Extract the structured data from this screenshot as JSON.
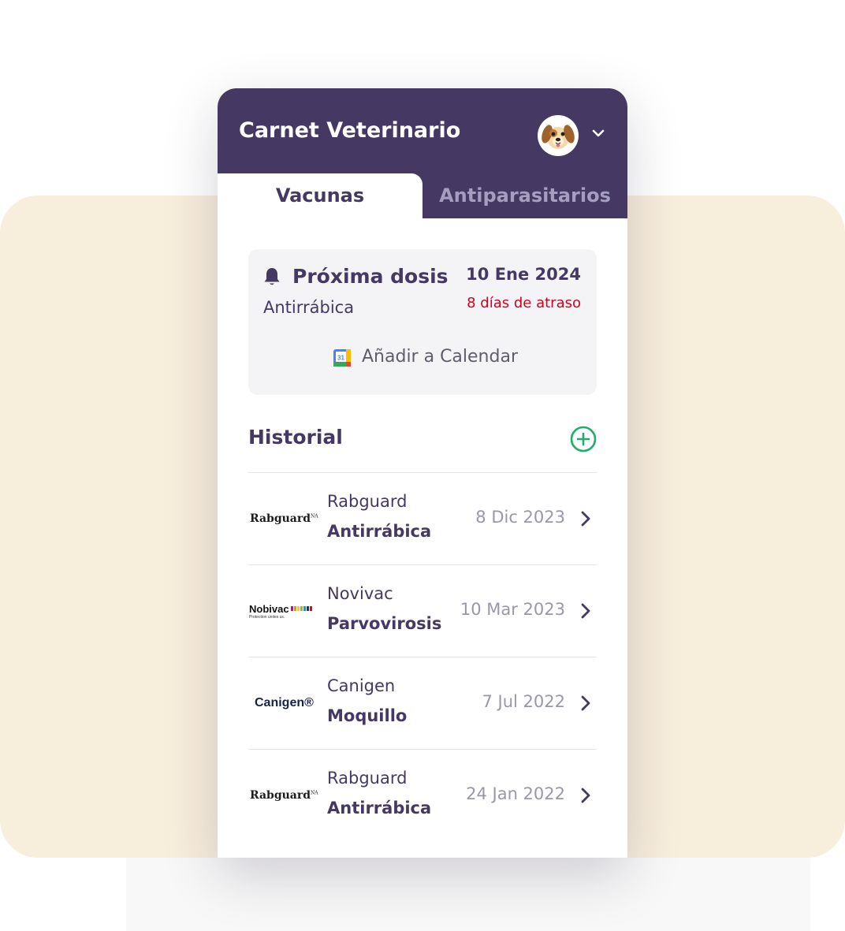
{
  "header": {
    "title": "Carnet Veterinario"
  },
  "tabs": [
    {
      "label": "Vacunas",
      "active": true
    },
    {
      "label": "Antiparasitarios",
      "active": false
    }
  ],
  "next_dose": {
    "title": "Próxima dosis",
    "vaccine": "Antirrábica",
    "date": "10 Ene 2024",
    "overdue": "8 días de atraso",
    "calendar_button": "Añadir a Calendar",
    "calendar_icon_text": "31"
  },
  "history": {
    "title": "Historial",
    "items": [
      {
        "logo": "Rabguard",
        "logo_mark": "NA",
        "brand": "Rabguard",
        "disease": "Antirrábica",
        "date": "8 Dic 2023"
      },
      {
        "logo": "Nobivac",
        "logo_sub": "Protection unites us.",
        "brand": "Novivac",
        "disease": "Parvovirosis",
        "date": "10 Mar 2023"
      },
      {
        "logo": "Canigen®",
        "brand": "Canigen",
        "disease": "Moquillo",
        "date": "7 Jul 2022"
      },
      {
        "logo": "Rabguard",
        "logo_mark": "NA",
        "brand": "Rabguard",
        "disease": "Antirrábica",
        "date": "24 Jan 2022"
      }
    ]
  },
  "colors": {
    "header_bg": "#453963",
    "accent_green": "#1fae6a",
    "overdue_red": "#d0021b",
    "page_beige": "#f8eedc"
  },
  "icons": {
    "bell": "bell-icon",
    "avatar": "dog-avatar",
    "chevron_down": "chevron-down-icon",
    "chevron_right": "chevron-right-icon",
    "add": "plus-circle-icon",
    "calendar": "google-calendar-icon"
  }
}
